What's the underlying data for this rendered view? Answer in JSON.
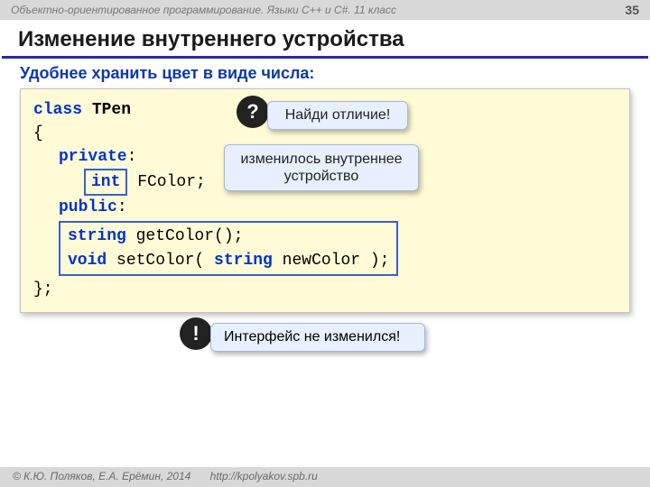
{
  "header": {
    "course": "Объектно-ориентированное программирование. Языки C++ и C#. 11 класс",
    "page": "35"
  },
  "title": "Изменение внутреннего устройства",
  "subtitle": "Удобнее хранить цвет в виде числа:",
  "code": {
    "kw_class": "class",
    "classname": "TPen",
    "lbrace": "{",
    "kw_private": "private",
    "int_kw": "int",
    "field": " FColor;",
    "kw_public": "public",
    "ret_string": "string",
    "get_fn": " getColor();",
    "ret_void": "void",
    "set_fn_a": " setColor( ",
    "param_type": "string",
    "set_fn_b": " newColor );",
    "rbrace": "};"
  },
  "callouts": {
    "question_glyph": "?",
    "find_diff": "Найди отличие!",
    "internal_changed": "изменилось внутреннее устройство",
    "excl_glyph": "!",
    "iface_same": "Интерфейс не изменился!"
  },
  "footer": {
    "copyright": "© К.Ю. Поляков, Е.А. Ерёмин, 2014",
    "url": "http://kpolyakov.spb.ru"
  }
}
